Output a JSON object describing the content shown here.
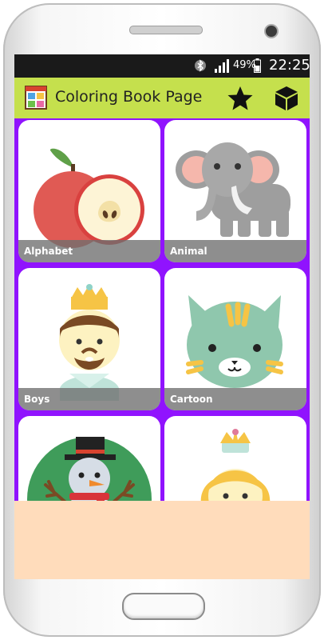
{
  "status_bar": {
    "battery_percent": "49%",
    "time": "22:25"
  },
  "app_bar": {
    "title": "Coloring Book Page",
    "accent_color": "#c5e04d"
  },
  "grid": {
    "background_color": "#9013fe",
    "cards": [
      {
        "label": "Alphabet",
        "image": "apple-icon"
      },
      {
        "label": "Animal",
        "image": "elephant-icon"
      },
      {
        "label": "Boys",
        "image": "prince-icon"
      },
      {
        "label": "Cartoon",
        "image": "cat-icon"
      },
      {
        "label": "",
        "image": "snowman-icon"
      },
      {
        "label": "",
        "image": "princess-icon"
      }
    ]
  },
  "bottom_panel": {
    "color": "#ffdcbb"
  }
}
